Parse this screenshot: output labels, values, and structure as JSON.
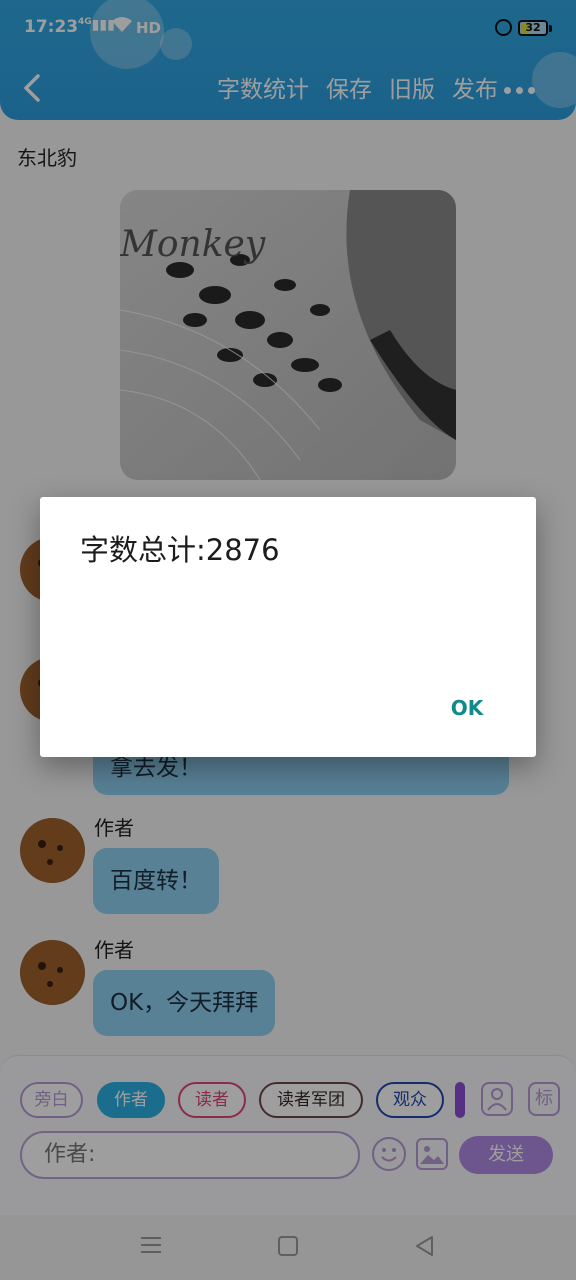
{
  "status_bar": {
    "time": "17:23",
    "signal_label": "4G",
    "network_label": "HD",
    "battery_level": "32"
  },
  "header": {
    "actions": [
      "字数统计",
      "保存",
      "旧版",
      "发布"
    ]
  },
  "story": {
    "title": "东北豹",
    "cover_text": "Monkey"
  },
  "messages": [
    {
      "name": "",
      "text": ""
    },
    {
      "name": "",
      "text": "拿去发！"
    },
    {
      "name": "作者",
      "text": "百度转！"
    },
    {
      "name": "作者",
      "text": "OK，今天拜拜"
    }
  ],
  "composer": {
    "roles": [
      {
        "label": "旁白",
        "color": "#b89ad9",
        "active": false
      },
      {
        "label": "作者",
        "color": "#2ab0e4",
        "active": true
      },
      {
        "label": "读者",
        "color": "#e2457a",
        "active": false
      },
      {
        "label": "读者军团",
        "color": "#6a4a45",
        "active": false
      },
      {
        "label": "观众",
        "color": "#2547b0",
        "active": false
      }
    ],
    "side_buttons": [
      "标"
    ],
    "input_value": "作者:",
    "send_label": "发送"
  },
  "dialog": {
    "message": "字数总计:2876",
    "ok_label": "OK"
  },
  "colors": {
    "header": "#2d9fe0",
    "bubble": "#8fd0f0",
    "send": "#b089e6",
    "dialog_button": "#0f8c88"
  }
}
